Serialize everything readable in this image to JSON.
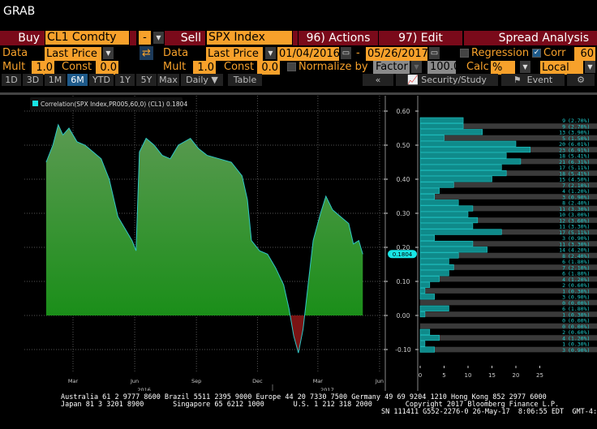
{
  "title": "GRAB",
  "row1": {
    "buy_label": "Buy",
    "buy_security": "CL1 Comdty",
    "operator": "-",
    "sell_label": "Sell",
    "sell_security": "SPX Index",
    "actions": "96) Actions",
    "edit": "97) Edit",
    "spread_analysis": "Spread Analysis"
  },
  "row2": {
    "data_label": "Data",
    "buy_data": "Last Price",
    "sell_data_label": "Data",
    "sell_data": "Last Price",
    "start_date": "01/04/2016",
    "date_sep": "-",
    "end_date": "05/26/2017",
    "regression_label": "Regression",
    "regression_checked": false,
    "corr_label": "Corr",
    "corr_checked": true,
    "corr_window": "60"
  },
  "row3": {
    "mult_label": "Mult",
    "buy_mult": "1.0",
    "const_label": "Const",
    "buy_const": "0.0",
    "sell_mult_label": "Mult",
    "sell_mult": "1.0",
    "sell_const_label": "Const",
    "sell_const": "0.0",
    "normalize_label": "Normalize by",
    "normalize_value": "Factor",
    "normalize_factor": "100.0",
    "calc_label": "Calc",
    "calc_value": "%",
    "currency": "Local"
  },
  "toolbar": {
    "periods": [
      "1D",
      "3D",
      "1M",
      "6M",
      "YTD",
      "1Y",
      "5Y",
      "Max"
    ],
    "active_period": "6M",
    "frequency": "Daily",
    "table": "Table",
    "collapse": "«",
    "security_study": "Security/Study",
    "event": "Event"
  },
  "chart_data": [
    {
      "type": "area",
      "legend": "Correlation(SPX Index,PR005,60,0) (CL1)  0.1804",
      "last_value_tag": "0.1804",
      "series_color": "#2fc6c6",
      "ylim": [
        -0.15,
        0.65
      ],
      "yticks": [
        "0.60",
        "0.50",
        "0.40",
        "0.30",
        "0.20",
        "0.10",
        "0.00",
        "-0.10"
      ],
      "xticks": [
        {
          "label": "Mar",
          "date": "2016-03-01"
        },
        {
          "label": "Jun",
          "date": "2016-06-01"
        },
        {
          "label": "Sep",
          "date": "2016-09-01"
        },
        {
          "label": "Dec",
          "date": "2016-12-01"
        },
        {
          "label": "Mar",
          "date": "2017-03-01"
        },
        {
          "label": "Jun",
          "date": "2017-06-01"
        }
      ],
      "years": [
        {
          "label": "2016",
          "date": "2016-06-15"
        },
        {
          "label": "2017",
          "date": "2017-03-15"
        }
      ],
      "points": [
        [
          "2016-01-21",
          0.45
        ],
        [
          "2016-01-31",
          0.5
        ],
        [
          "2016-02-08",
          0.56
        ],
        [
          "2016-02-15",
          0.53
        ],
        [
          "2016-02-24",
          0.55
        ],
        [
          "2016-03-07",
          0.51
        ],
        [
          "2016-03-19",
          0.5
        ],
        [
          "2016-03-31",
          0.48
        ],
        [
          "2016-04-12",
          0.46
        ],
        [
          "2016-04-24",
          0.4
        ],
        [
          "2016-05-07",
          0.29
        ],
        [
          "2016-05-19",
          0.25
        ],
        [
          "2016-05-28",
          0.22
        ],
        [
          "2016-06-03",
          0.19
        ],
        [
          "2016-06-08",
          0.48
        ],
        [
          "2016-06-18",
          0.52
        ],
        [
          "2016-06-30",
          0.5
        ],
        [
          "2016-07-12",
          0.47
        ],
        [
          "2016-07-24",
          0.46
        ],
        [
          "2016-08-05",
          0.5
        ],
        [
          "2016-08-23",
          0.52
        ],
        [
          "2016-09-04",
          0.49
        ],
        [
          "2016-09-17",
          0.47
        ],
        [
          "2016-10-05",
          0.46
        ],
        [
          "2016-10-23",
          0.45
        ],
        [
          "2016-11-08",
          0.41
        ],
        [
          "2016-11-16",
          0.34
        ],
        [
          "2016-11-22",
          0.22
        ],
        [
          "2016-12-04",
          0.19
        ],
        [
          "2016-12-16",
          0.18
        ],
        [
          "2016-12-28",
          0.14
        ],
        [
          "2017-01-09",
          0.09
        ],
        [
          "2017-01-17",
          0.02
        ],
        [
          "2017-01-24",
          -0.06
        ],
        [
          "2017-01-31",
          -0.11
        ],
        [
          "2017-02-07",
          -0.04
        ],
        [
          "2017-02-15",
          0.1
        ],
        [
          "2017-02-22",
          0.22
        ],
        [
          "2017-03-05",
          0.3
        ],
        [
          "2017-03-13",
          0.35
        ],
        [
          "2017-03-23",
          0.31
        ],
        [
          "2017-04-04",
          0.29
        ],
        [
          "2017-04-16",
          0.27
        ],
        [
          "2017-04-23",
          0.21
        ],
        [
          "2017-05-01",
          0.22
        ],
        [
          "2017-05-07",
          0.18
        ]
      ]
    },
    {
      "type": "bar",
      "orientation": "horizontal",
      "title": "Distribution",
      "xticks": [
        "0",
        "5",
        "10",
        "15",
        "20",
        "25"
      ],
      "xlim": [
        0,
        25
      ],
      "counts": [
        9,
        9,
        13,
        5,
        20,
        23,
        18,
        21,
        17,
        18,
        15,
        7,
        4,
        3,
        8,
        11,
        10,
        12,
        11,
        17,
        3,
        11,
        14,
        8,
        6,
        7,
        6,
        4,
        2,
        1,
        3,
        0,
        6,
        1,
        0,
        0,
        2,
        4,
        1,
        3
      ],
      "percents": [
        "(2.70%)",
        "(2.70%)",
        "(3.90%)",
        "(1.50%)",
        "(6.01%)",
        "(6.91%)",
        "(5.41%)",
        "(6.31%)",
        "(5.11%)",
        "(5.41%)",
        "(4.50%)",
        "(2.10%)",
        "(1.20%)",
        "(0.90%)",
        "(2.40%)",
        "(3.30%)",
        "(3.00%)",
        "(3.60%)",
        "(3.30%)",
        "(5.11%)",
        "(0.90%)",
        "(3.30%)",
        "(4.20%)",
        "(2.40%)",
        "(1.80%)",
        "(2.10%)",
        "(1.80%)",
        "(1.20%)",
        "(0.60%)",
        "(0.30%)",
        "(0.90%)",
        "(0.00%)",
        "(1.80%)",
        "(0.30%)",
        "(0.00%)",
        "(0.00%)",
        "(0.60%)",
        "(1.20%)",
        "(0.30%)",
        "(0.90%)"
      ]
    }
  ],
  "footer": {
    "line1": "Australia 61 2 9777 8600 Brazil 5511 2395 9000 Europe 44 20 7330 7500 Germany 49 69 9204 1210 Hong Kong 852 2977 6000",
    "line2": "Japan 81 3 3201 8900       Singapore 65 6212 1000       U.S. 1 212 318 2000        Copyright 2017 Bloomberg Finance L.P.",
    "line3": "SN 111411 G552-2276-0 26-May-17  8:06:55 EDT  GMT-4:00"
  }
}
